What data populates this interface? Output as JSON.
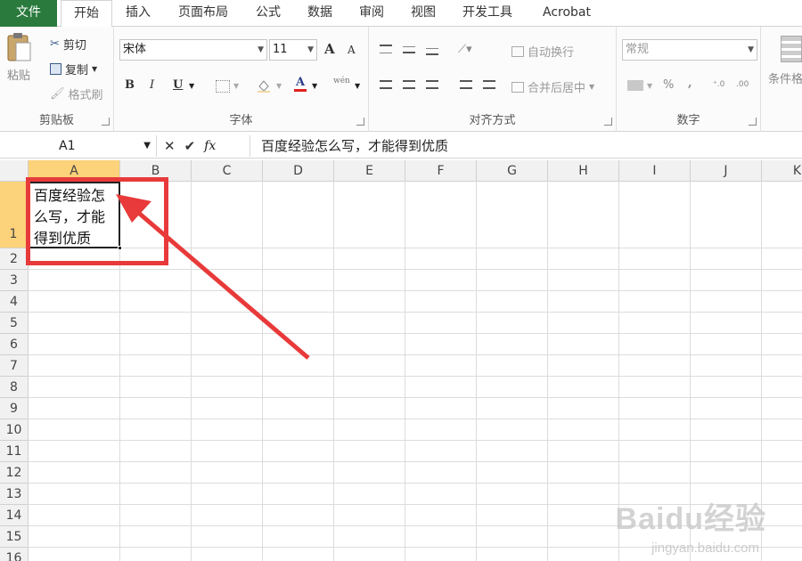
{
  "tabs": [
    {
      "label": "文件"
    },
    {
      "label": "开始"
    },
    {
      "label": "插入"
    },
    {
      "label": "页面布局"
    },
    {
      "label": "公式"
    },
    {
      "label": "数据"
    },
    {
      "label": "审阅"
    },
    {
      "label": "视图"
    },
    {
      "label": "开发工具"
    },
    {
      "label": "Acrobat"
    }
  ],
  "ribbon": {
    "clipboard": {
      "paste": "粘贴",
      "cut": "剪切",
      "copy": "复制",
      "format_painter": "格式刷",
      "label": "剪贴板"
    },
    "font": {
      "font_name": "宋体",
      "font_size": "11",
      "grow": "A",
      "shrink": "A",
      "bold": "B",
      "italic": "I",
      "underline": "U",
      "font_color": "A",
      "wen": "wén",
      "label": "字体"
    },
    "alignment": {
      "wrap_text": "自动换行",
      "merge_center": "合并后居中",
      "label": "对齐方式"
    },
    "number": {
      "format": "常规",
      "percent": "%",
      "comma": ",",
      "label": "数字"
    },
    "conditional": {
      "label": "条件格"
    }
  },
  "formula_bar": {
    "name_box": "A1",
    "fx": "fx",
    "content": "百度经验怎么写，才能得到优质"
  },
  "sheet": {
    "columns": [
      "A",
      "B",
      "C",
      "D",
      "E",
      "F",
      "G",
      "H",
      "I",
      "J",
      "K"
    ],
    "rows": [
      "1",
      "2",
      "3",
      "4",
      "5",
      "6",
      "7",
      "8",
      "9",
      "10",
      "11",
      "12",
      "13",
      "14",
      "15",
      "16"
    ],
    "cell_a1": "百度经验怎么写，才能得到优质"
  },
  "watermark": {
    "logo": "Baidu经验",
    "sub": "jingyan.baidu.com"
  },
  "colors": {
    "file_tab": "#2a7a3e",
    "selection_header": "#fcd27a",
    "annotation": "#e83a3a"
  }
}
